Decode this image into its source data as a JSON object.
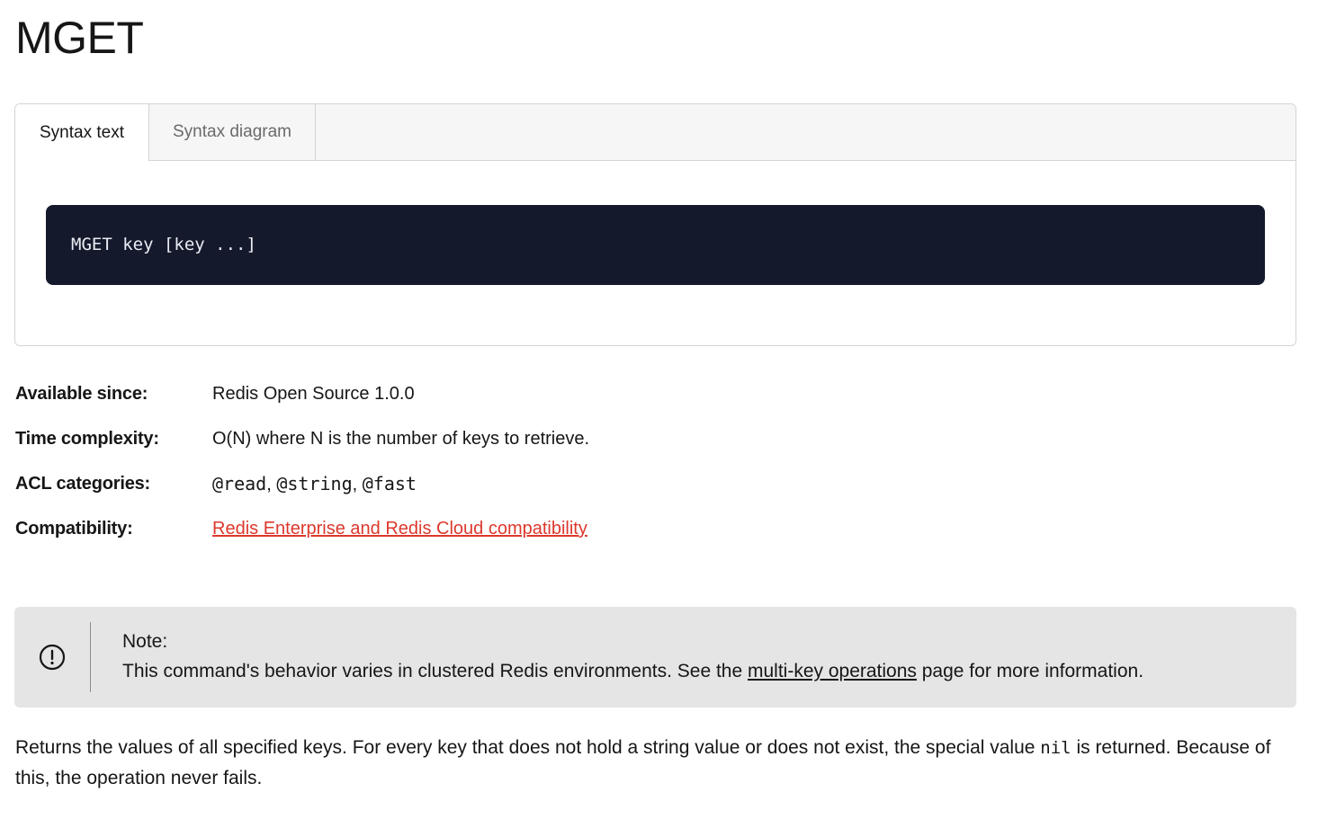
{
  "page": {
    "title": "MGET"
  },
  "syntax": {
    "tabs": [
      {
        "label": "Syntax text",
        "active": true
      },
      {
        "label": "Syntax diagram",
        "active": false
      }
    ],
    "code": "MGET key [key ...]"
  },
  "meta": {
    "available_since": {
      "label": "Available since:",
      "value": "Redis Open Source 1.0.0"
    },
    "time_complexity": {
      "label": "Time complexity:",
      "value": "O(N) where N is the number of keys to retrieve."
    },
    "acl_categories": {
      "label": "ACL categories:",
      "items": [
        "@read",
        "@string",
        "@fast"
      ],
      "separator": ", "
    },
    "compatibility": {
      "label": "Compatibility:",
      "link_text": "Redis Enterprise and Redis Cloud compatibility"
    }
  },
  "note": {
    "icon": "exclamation-circle-icon",
    "title": "Note:",
    "body_before": "This command's behavior varies in clustered Redis environments. See the ",
    "link_text": "multi-key operations",
    "body_after": " page for more information."
  },
  "description": {
    "part1": "Returns the values of all specified keys. For every key that does not hold a string value or does not exist, the special value ",
    "code": "nil",
    "part2": " is returned. Because of this, the operation never fails."
  },
  "colors": {
    "code_bg": "#141a2c",
    "link_red": "#dc382d",
    "note_bg": "#e5e5e5"
  }
}
